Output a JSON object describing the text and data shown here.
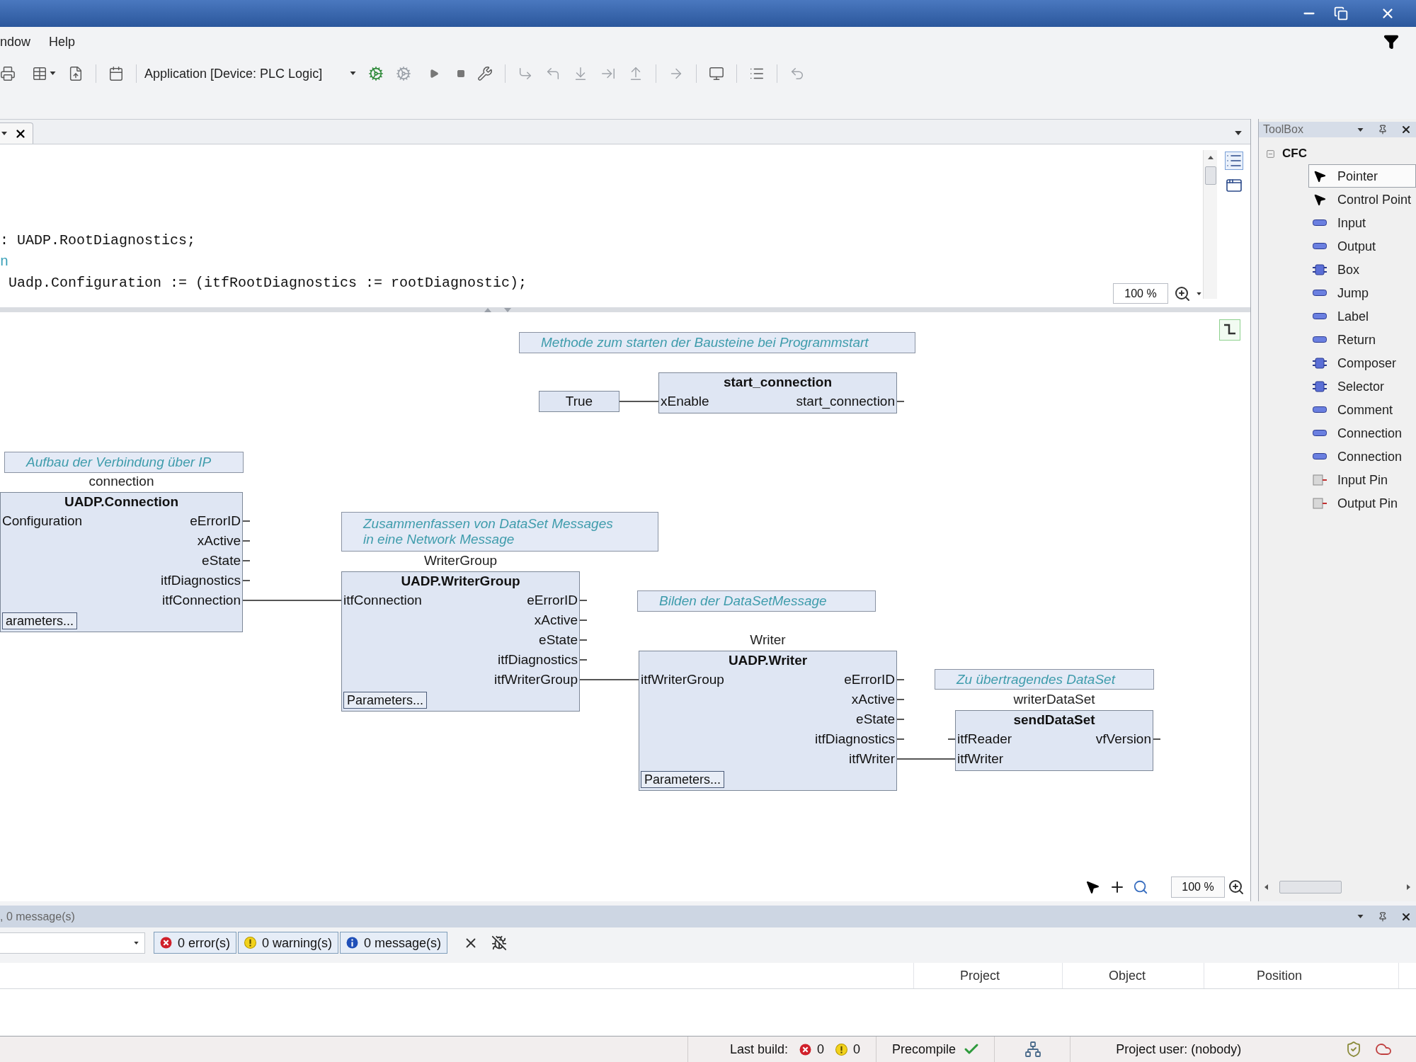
{
  "menu": [
    {
      "label": "ndow"
    },
    {
      "label": "Help"
    }
  ],
  "toolbar": {
    "target": "Application [Device: PLC Logic]"
  },
  "editor": {
    "code_lines": [
      {
        "kind": "plain",
        "text": ": UADP.RootDiagnostics;"
      },
      {
        "kind": "keyword",
        "text": "n"
      },
      {
        "kind": "plain",
        "text": " Uadp.Configuration := (itfRootDiagnostics := rootDiagnostic);"
      }
    ],
    "zoom": "100 %"
  },
  "diagram": {
    "comments": [
      {
        "text": "Methode zum starten der Bausteine bei Programmstart"
      },
      {
        "text": "Aufbau der Verbindung über IP"
      },
      {
        "text": "Zusammenfassen von DataSet Messages\nin eine Network Message"
      },
      {
        "text": "Bilden der DataSetMessage"
      },
      {
        "text": "Zu übertragendes DataSet"
      }
    ],
    "constants": [
      {
        "value": "True"
      }
    ],
    "blocks": [
      {
        "type": "start_connection",
        "inputs": [
          "xEnable"
        ],
        "outputs": [
          "start_connection"
        ]
      },
      {
        "instance": "connection",
        "type": "UADP.Connection",
        "inputs": [
          "Configuration"
        ],
        "outputs": [
          "eErrorID",
          "xActive",
          "eState",
          "itfDiagnostics",
          "itfConnection"
        ],
        "parameters": "arameters..."
      },
      {
        "instance": "WriterGroup",
        "type": "UADP.WriterGroup",
        "inputs": [
          "itfConnection"
        ],
        "outputs": [
          "eErrorID",
          "xActive",
          "eState",
          "itfDiagnostics",
          "itfWriterGroup"
        ],
        "parameters": "Parameters..."
      },
      {
        "instance": "Writer",
        "type": "UADP.Writer",
        "inputs": [
          "itfWriterGroup"
        ],
        "outputs": [
          "eErrorID",
          "xActive",
          "eState",
          "itfDiagnostics",
          "itfWriter"
        ],
        "parameters": "Parameters..."
      },
      {
        "instance": "writerDataSet",
        "type": "sendDataSet",
        "inputs": [
          "itfReader",
          "itfWriter"
        ],
        "outputs": [
          "vfVersion"
        ]
      }
    ],
    "zoom": "100 %"
  },
  "toolbox": {
    "title": "ToolBox",
    "groups": [
      {
        "label": "CFC",
        "expanded": true,
        "children": [
          {
            "label": "Pointer",
            "selected": true
          },
          {
            "label": "Control Point",
            "selected": false
          },
          {
            "label": "Input",
            "selected": false
          },
          {
            "label": "Output",
            "selected": false
          },
          {
            "label": "Box",
            "selected": false
          },
          {
            "label": "Jump",
            "selected": false
          },
          {
            "label": "Label",
            "selected": false
          },
          {
            "label": "Return",
            "selected": false
          },
          {
            "label": "Composer",
            "selected": false
          },
          {
            "label": "Selector",
            "selected": false
          },
          {
            "label": "Comment",
            "selected": false
          },
          {
            "label": "Connection",
            "selected": false
          },
          {
            "label": "Connection",
            "selected": false
          },
          {
            "label": "Input Pin",
            "selected": false
          },
          {
            "label": "Output Pin",
            "selected": false
          }
        ]
      }
    ]
  },
  "messages": {
    "title": ", 0 message(s)",
    "filters": [
      {
        "kind": "error",
        "label": "0 error(s)",
        "selected": true
      },
      {
        "kind": "warning",
        "label": "0 warning(s)",
        "selected": true
      },
      {
        "kind": "info",
        "label": "0 message(s)",
        "selected": true
      }
    ],
    "columns": [
      "Project",
      "Object",
      "Position"
    ]
  },
  "status_bar": {
    "last_build": "Last build:",
    "errors": "0",
    "warnings": "0",
    "precompile": {
      "label": "Precompile",
      "ok": true
    },
    "project_user": "Project user: (nobody)"
  }
}
